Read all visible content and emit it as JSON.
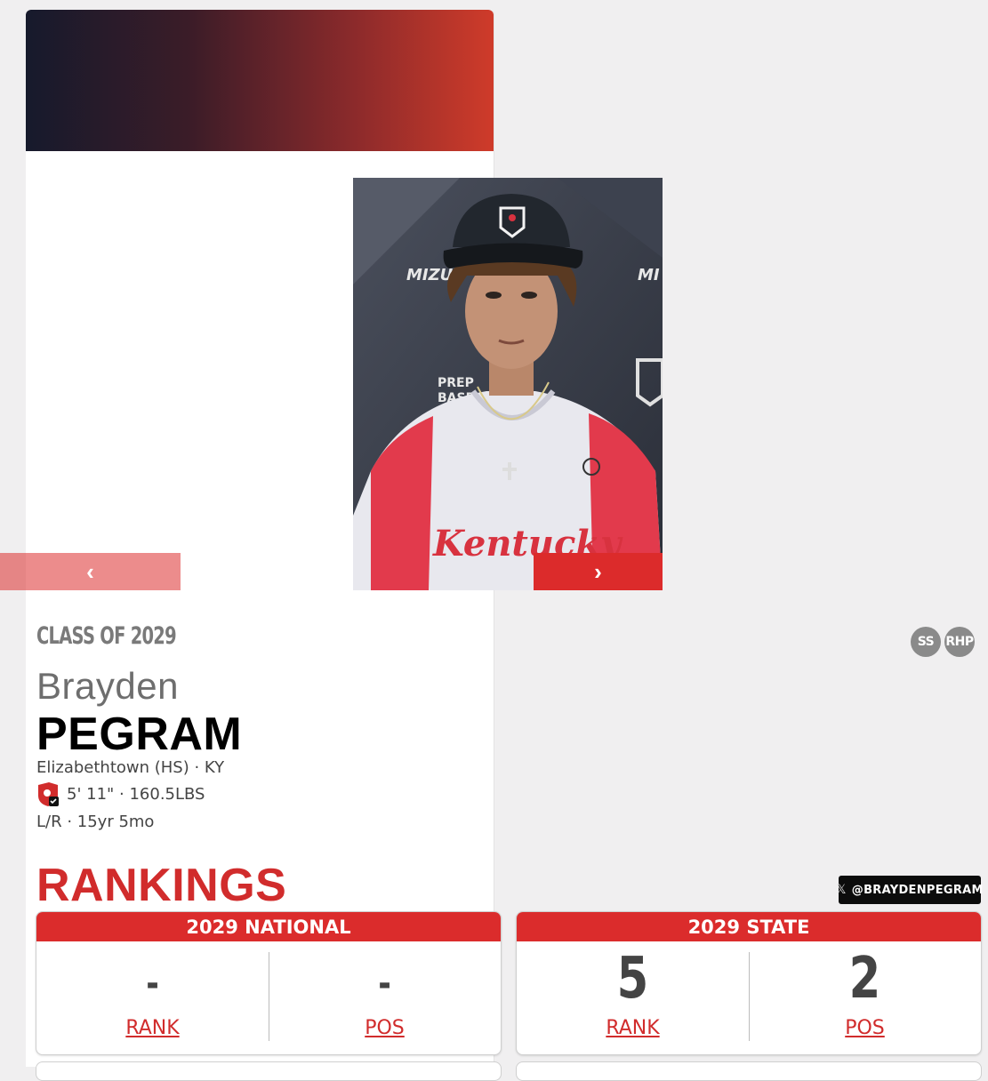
{
  "player": {
    "class_of": "CLASS OF 2029",
    "first_name": "Brayden",
    "last_name": "PEGRAM",
    "school_line": "Elizabethtown (HS) · KY",
    "size_line": "5' 11\" · 160.5LBS",
    "bats_age_line": "L/R · 15yr 5mo",
    "positions": [
      "SS",
      "RHP"
    ]
  },
  "photo": {
    "prev_label": "‹",
    "next_label": "›",
    "jersey_text": "Kentucky"
  },
  "social": {
    "handle": "@BRAYDENPEGRAM",
    "icon": "x-logo-icon"
  },
  "rankings": {
    "title": "RANKINGS",
    "national": {
      "header": "2029 NATIONAL",
      "rank": "-",
      "pos": "-",
      "rank_label": "RANK",
      "pos_label": "POS"
    },
    "state": {
      "header": "2029 STATE",
      "rank": "5",
      "pos": "2",
      "rank_label": "RANK",
      "pos_label": "POS"
    }
  },
  "colors": {
    "accent_red": "#d12c2c",
    "banner_dark": "#161a2c",
    "banner_red": "#cf3b2a"
  }
}
